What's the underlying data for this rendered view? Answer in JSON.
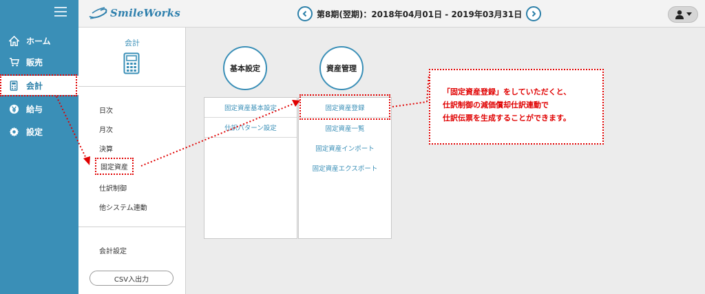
{
  "app": {
    "name": "SmileWorks"
  },
  "header": {
    "period_label": "第8期(翌期)：2018年04月01日 - 2019年03月31日",
    "prev_icon": "chevron-left-icon",
    "next_icon": "chevron-right-icon",
    "user_icon": "user-icon"
  },
  "nav": {
    "items": [
      {
        "label": "ホーム",
        "icon": "home-icon"
      },
      {
        "label": "販売",
        "icon": "cart-icon"
      },
      {
        "label": "会計",
        "icon": "calculator-icon"
      },
      {
        "label": "給与",
        "icon": "yen-icon"
      },
      {
        "label": "設定",
        "icon": "gear-icon"
      }
    ],
    "active_index": 2
  },
  "subnav": {
    "title": "会計",
    "items": [
      {
        "label": "日次"
      },
      {
        "label": "月次"
      },
      {
        "label": "決算"
      },
      {
        "label": "固定資産"
      },
      {
        "label": "仕訳制御"
      },
      {
        "label": "他システム連動"
      },
      {
        "label": "会計設定"
      }
    ],
    "active_index": 3,
    "csv_button": "CSV入出力"
  },
  "main": {
    "basic": {
      "title": "基本設定",
      "items": [
        {
          "label": "固定資産基本設定"
        },
        {
          "label": "仕訳パターン設定"
        }
      ]
    },
    "asset": {
      "title": "資産管理",
      "items": [
        {
          "label": "固定資産登録"
        },
        {
          "label": "固定資産一覧"
        },
        {
          "label": "固定資産インポート"
        },
        {
          "label": "固定資産エクスポート"
        }
      ]
    }
  },
  "callout": {
    "lines": [
      "「固定資産登録」をしていただくと、",
      "仕訳制御の減価償却仕訳連動で",
      "仕訳伝票を生成することができます。"
    ]
  },
  "colors": {
    "nav_bg": "#3a8fb7",
    "accent": "#2b7fa8",
    "annotation": "#e00000"
  }
}
